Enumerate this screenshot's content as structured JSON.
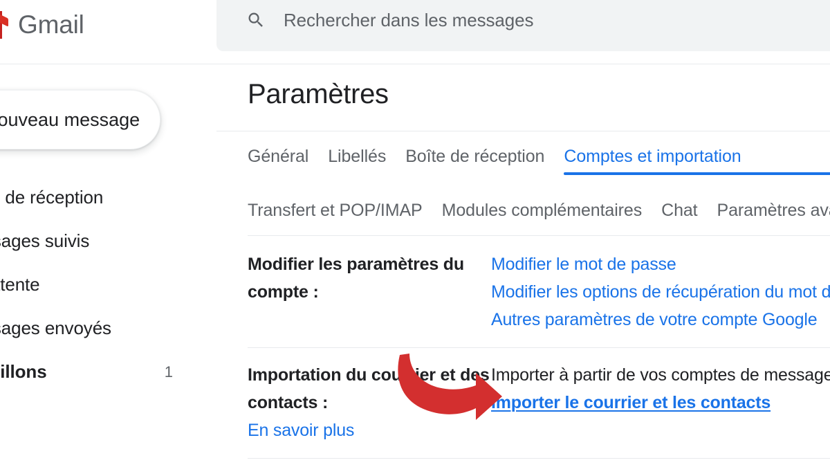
{
  "app": {
    "brand": "Gmail",
    "logo_icon": "gmail-envelope-icon",
    "accent_blue": "#1a73e8",
    "brand_red": "#d93025",
    "annotation_red": "#d32f2f"
  },
  "search": {
    "icon": "search-icon",
    "placeholder": "Rechercher dans les messages",
    "value": ""
  },
  "sidebar": {
    "compose_label": "Nouveau message",
    "items": [
      {
        "label": "Boîte de réception",
        "count": "",
        "bold": false
      },
      {
        "label": "Messages suivis",
        "count": "",
        "bold": false
      },
      {
        "label": "En attente",
        "count": "",
        "bold": false
      },
      {
        "label": "Messages envoyés",
        "count": "",
        "bold": false
      },
      {
        "label": "Brouillons",
        "count": "1",
        "bold": true
      }
    ]
  },
  "main": {
    "title": "Paramètres",
    "tabs_row1": [
      {
        "label": "Général",
        "active": false
      },
      {
        "label": "Libellés",
        "active": false
      },
      {
        "label": "Boîte de réception",
        "active": false
      },
      {
        "label": "Comptes et importation",
        "active": true
      }
    ],
    "tabs_row2": [
      {
        "label": "Transfert et POP/IMAP",
        "active": false
      },
      {
        "label": "Modules complémentaires",
        "active": false
      },
      {
        "label": "Chat",
        "active": false
      },
      {
        "label": "Paramètres avancés",
        "active": false
      }
    ],
    "rows": [
      {
        "label": "Modifier les paramètres du compte :",
        "sublink": "",
        "links": [
          {
            "text": "Modifier le mot de passe",
            "emphasis": false
          },
          {
            "text": "Modifier les options de récupération du mot de passe",
            "emphasis": false
          },
          {
            "text": "Autres paramètres de votre compte Google",
            "emphasis": false
          }
        ],
        "plain_lines": []
      },
      {
        "label": "Importation du courrier et des contacts :",
        "sublink": "En savoir plus",
        "plain_lines": [
          "Importer à partir de vos comptes de messagerie"
        ],
        "links": [
          {
            "text": "Importer le courrier et les contacts",
            "emphasis": true
          }
        ]
      }
    ]
  },
  "annotation": {
    "type": "curved-arrow",
    "color": "#d32f2f",
    "points_to": "Importer le courrier et les contacts"
  }
}
